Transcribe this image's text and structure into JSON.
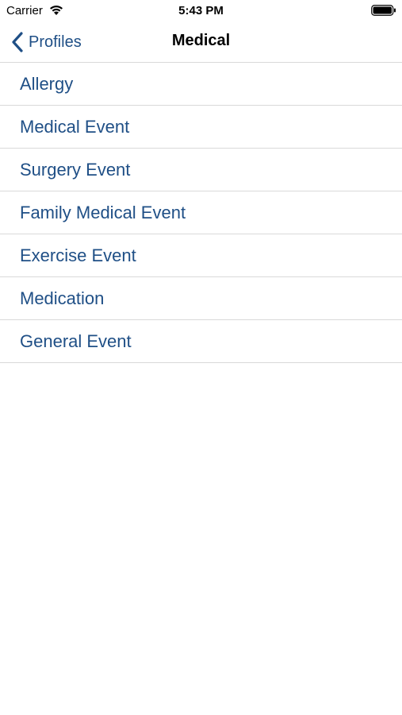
{
  "status_bar": {
    "carrier": "Carrier",
    "time": "5:43 PM",
    "wifi_icon": "wifi-icon",
    "battery_icon": "battery-icon"
  },
  "nav_bar": {
    "back_label": "Profiles",
    "back_icon": "chevron-left-icon",
    "title": "Medical"
  },
  "menu": {
    "items": [
      {
        "label": "Allergy"
      },
      {
        "label": "Medical Event"
      },
      {
        "label": "Surgery Event"
      },
      {
        "label": "Family Medical Event"
      },
      {
        "label": "Exercise Event"
      },
      {
        "label": "Medication"
      },
      {
        "label": "General Event"
      }
    ]
  },
  "colors": {
    "accent": "#1f4f86",
    "separator": "#d9d9d9",
    "background": "#ffffff"
  }
}
